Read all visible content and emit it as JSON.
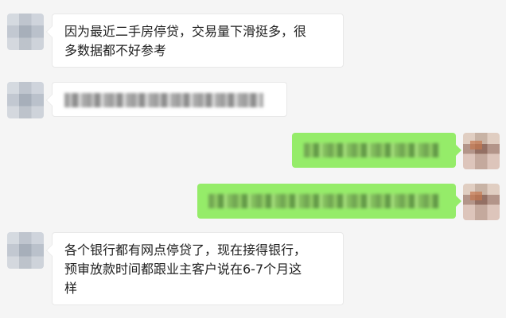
{
  "chat": {
    "messages": [
      {
        "sender": "left",
        "text": "因为最近二手房停贷，交易量下滑挺多，很\n多数据都不好参考"
      },
      {
        "sender": "left",
        "text": ""
      },
      {
        "sender": "right",
        "text": ""
      },
      {
        "sender": "right",
        "text": ""
      },
      {
        "sender": "left",
        "text": "各个银行都有网点停贷了，现在接得银行，\n预审放款时间都跟业主客户说在6-7个月这\n样"
      }
    ]
  },
  "theme": {
    "background": "#f5f5f5",
    "left_bubble": "#ffffff",
    "right_bubble": "#95ec69"
  },
  "icons": {
    "left_avatar": "contact-avatar-icon",
    "right_avatar": "self-avatar-icon"
  }
}
